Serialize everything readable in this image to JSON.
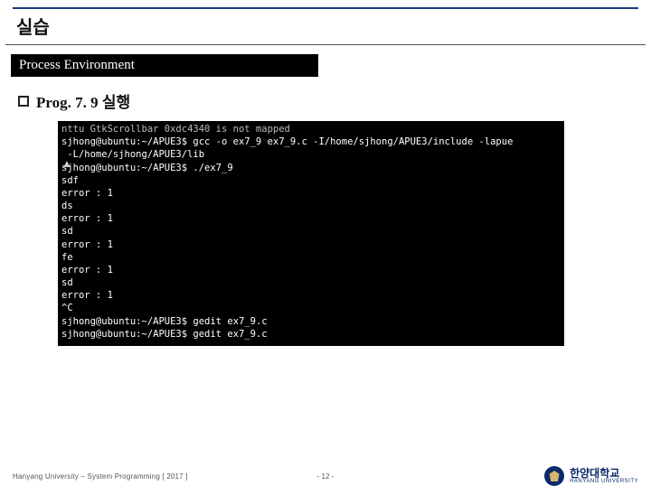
{
  "slide": {
    "title": "실습",
    "section_label": "Process Environment",
    "bullet_label": "Prog. 7. 9 실행"
  },
  "terminal": {
    "lines": [
      "nttu GtkScrollbar 0xdc4340 is not mapped",
      "sjhong@ubuntu:~/APUE3$ gcc -o ex7_9 ex7_9.c -I/home/sjhong/APUE3/include -lapue",
      " -L/home/sjhong/APUE3/lib",
      "sjhong@ubuntu:~/APUE3$ ./ex7_9",
      "sdf",
      "error : 1",
      "ds",
      "error : 1",
      "sd",
      "error : 1",
      "fe",
      "error : 1",
      "sd",
      "error : 1",
      "^C",
      "sjhong@ubuntu:~/APUE3$ gedit ex7_9.c",
      "sjhong@ubuntu:~/APUE3$ gedit ex7_9.c"
    ]
  },
  "footer": {
    "left": "Hanyang University – System Programming  [ 2017 ]",
    "page": "- 12 -",
    "logo_kr": "한양대학교",
    "logo_en": "HANYANG UNIVERSITY"
  }
}
